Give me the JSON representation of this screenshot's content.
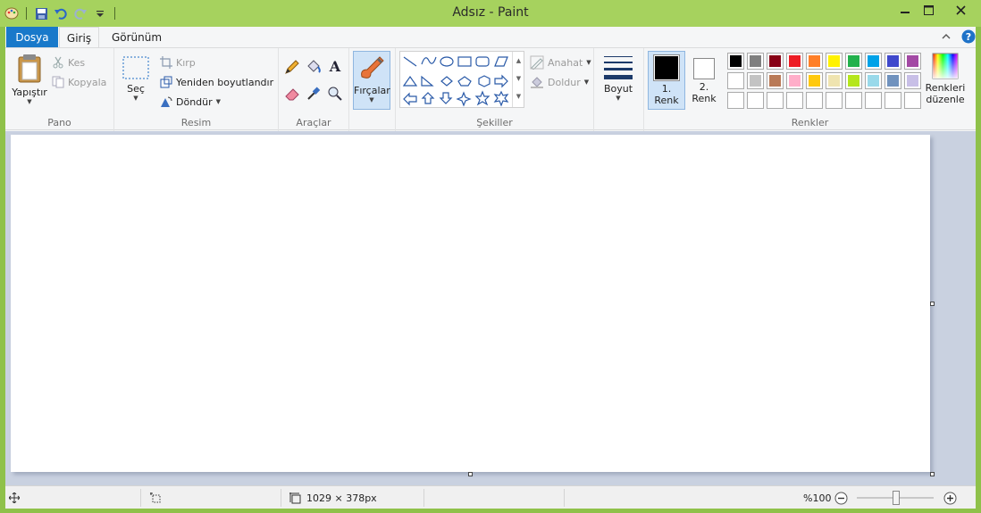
{
  "window": {
    "title": "Adsız - Paint"
  },
  "quick_access": {
    "icons": [
      "paint-app-icon",
      "save-icon",
      "undo-icon",
      "redo-icon",
      "customize-qat-icon"
    ]
  },
  "tabs": [
    {
      "label": "Dosya"
    },
    {
      "label": "Giriş"
    },
    {
      "label": "Görünüm"
    }
  ],
  "groups": {
    "clipboard": {
      "label": "Pano",
      "paste": "Yapıştır",
      "cut": "Kes",
      "copy": "Kopyala"
    },
    "image": {
      "label": "Resim",
      "select": "Seç",
      "crop": "Kırp",
      "resize": "Yeniden boyutlandır",
      "rotate": "Döndür"
    },
    "tools": {
      "label": "Araçlar"
    },
    "brushes": {
      "label": "Fırçalar"
    },
    "shapes": {
      "label": "Şekiller",
      "outline": "Anahat",
      "fill": "Doldur"
    },
    "size": {
      "label": "Boyut"
    },
    "colors": {
      "label": "Renkler",
      "color1_line1": "1.",
      "color1_line2": "Renk",
      "color2_line1": "2.",
      "color2_line2": "Renk",
      "edit_line1": "Renkleri",
      "edit_line2": "düzenle",
      "color1": "#000000",
      "color2": "#ffffff",
      "palette_row1": [
        "#000000",
        "#7f7f7f",
        "#880015",
        "#ed1c24",
        "#ff7f27",
        "#fff200",
        "#22b14c",
        "#00a2e8",
        "#3f48cc",
        "#a349a4"
      ],
      "palette_row2": [
        "#ffffff",
        "#c3c3c3",
        "#b97a57",
        "#ffaec9",
        "#ffc90e",
        "#efe4b0",
        "#b5e61d",
        "#99d9ea",
        "#7092be",
        "#c8bfe7"
      ]
    }
  },
  "status": {
    "canvas_size": "1029 × 378px",
    "zoom": "%100"
  }
}
